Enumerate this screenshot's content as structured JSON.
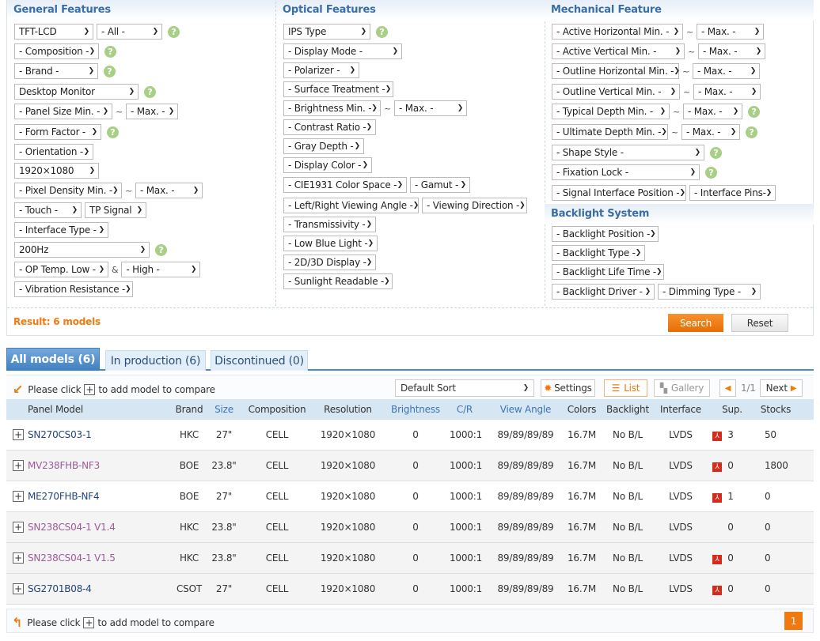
{
  "filters": {
    "general": {
      "title": "General Features",
      "rows": [
        [
          "TFT-LCD",
          "- All -",
          "?"
        ],
        [
          "- Composition -",
          "?"
        ],
        [
          "- Brand -",
          "?"
        ],
        [
          "Desktop Monitor",
          "?"
        ],
        [
          "- Panel Size Min. -",
          "~",
          "- Max. -"
        ],
        [
          "- Form Factor -",
          "?"
        ],
        [
          "- Orientation -"
        ],
        [
          "1920×1080"
        ],
        [
          "- Pixel Density Min. -",
          "~",
          "- Max. -"
        ],
        [
          "- Touch -",
          "TP Signal"
        ],
        [
          "- Interface Type -"
        ],
        [
          "200Hz",
          "?"
        ],
        [
          "- OP Temp. Low -",
          "&",
          "- High -"
        ],
        [
          "- Vibration Resistance -"
        ]
      ]
    },
    "optical": {
      "title": "Optical Features",
      "rows": [
        [
          "IPS Type",
          "?"
        ],
        [
          "- Display Mode -"
        ],
        [
          "- Polarizer -"
        ],
        [
          "- Surface Treatment -"
        ],
        [
          "- Brightness Min. -",
          "~",
          "- Max. -"
        ],
        [
          "- Contrast Ratio -"
        ],
        [
          "- Gray Depth -"
        ],
        [
          "- Display Color -"
        ],
        [
          "- CIE1931 Color Space -",
          "- Gamut -"
        ],
        [
          "- Left/Right Viewing Angle -",
          "- Viewing Direction -"
        ],
        [
          "- Transmissivity -"
        ],
        [
          "- Low Blue Light -"
        ],
        [
          "- 2D/3D Display -"
        ],
        [
          "- Sunlight Readable -"
        ]
      ]
    },
    "mechanical": {
      "title": "Mechanical Feature",
      "rows": [
        [
          "- Active Horizontal Min. -",
          "~",
          "- Max. -"
        ],
        [
          "- Active Vertical Min. -",
          "~",
          "- Max. -"
        ],
        [
          "- Outline Horizontal Min. -",
          "~",
          "- Max. -"
        ],
        [
          "- Outline Vertical Min. -",
          "~",
          "- Max. -"
        ],
        [
          "- Typical Depth Min. -",
          "~",
          "- Max. -",
          "?"
        ],
        [
          "- Ultimate Depth Min. -",
          "~",
          "- Max. -",
          "?"
        ],
        [
          "- Shape Style -",
          "?"
        ],
        [
          "- Fixation Lock -",
          "?"
        ],
        [
          "- Signal Interface Position -",
          "- Interface Pins-"
        ]
      ]
    },
    "backlight": {
      "title": "Backlight System",
      "rows": [
        [
          "- Backlight Position -"
        ],
        [
          "- Backlight Type -"
        ],
        [
          "- Backlight Life Time -"
        ],
        [
          "- Backlight Driver -",
          "- Dimming Type -"
        ]
      ]
    },
    "result": "Result: 6 models",
    "search_label": "Search",
    "reset_label": "Reset"
  },
  "tabs": [
    "All models (6)",
    "In production (6)",
    "Discontinued (0)"
  ],
  "toolbar": {
    "compare_pre": "Please click",
    "compare_post": "to add model to compare",
    "sort": "Default Sort",
    "settings": "Settings",
    "list": "List",
    "gallery": "Gallery",
    "page": "1/1",
    "next": "Next"
  },
  "table": {
    "headers": [
      "Panel Model",
      "Brand",
      "Size",
      "Composition",
      "Resolution",
      "Brightness",
      "C/R",
      "View Angle",
      "Colors",
      "Backlight",
      "Interface",
      "Sup.",
      "Stocks"
    ],
    "rows": [
      {
        "model": "SN270CS03-1",
        "brand": "HKC",
        "size": "27\"",
        "composition": "CELL",
        "resolution": "1920×1080",
        "brightness": "0",
        "cr": "1000:1",
        "view_angle": "89/89/89/89",
        "colors": "16.7M",
        "backlight": "No B/L",
        "interface": "LVDS",
        "pdf": true,
        "sup": "3",
        "stocks": "50",
        "visited": false
      },
      {
        "model": "MV238FHB-NF3",
        "brand": "BOE",
        "size": "23.8\"",
        "composition": "CELL",
        "resolution": "1920×1080",
        "brightness": "0",
        "cr": "1000:1",
        "view_angle": "89/89/89/89",
        "colors": "16.7M",
        "backlight": "No B/L",
        "interface": "LVDS",
        "pdf": true,
        "sup": "0",
        "stocks": "1800",
        "visited": true
      },
      {
        "model": "ME270FHB-NF4",
        "brand": "BOE",
        "size": "27\"",
        "composition": "CELL",
        "resolution": "1920×1080",
        "brightness": "0",
        "cr": "1000:1",
        "view_angle": "89/89/89/89",
        "colors": "16.7M",
        "backlight": "No B/L",
        "interface": "LVDS",
        "pdf": true,
        "sup": "1",
        "stocks": "0",
        "visited": false
      },
      {
        "model": "SN238CS04-1 V1.4",
        "brand": "HKC",
        "size": "23.8\"",
        "composition": "CELL",
        "resolution": "1920×1080",
        "brightness": "0",
        "cr": "1000:1",
        "view_angle": "89/89/89/89",
        "colors": "16.7M",
        "backlight": "No B/L",
        "interface": "LVDS",
        "pdf": false,
        "sup": "0",
        "stocks": "0",
        "visited": true
      },
      {
        "model": "SN238CS04-1 V1.5",
        "brand": "HKC",
        "size": "23.8\"",
        "composition": "CELL",
        "resolution": "1920×1080",
        "brightness": "0",
        "cr": "1000:1",
        "view_angle": "89/89/89/89",
        "colors": "16.7M",
        "backlight": "No B/L",
        "interface": "LVDS",
        "pdf": true,
        "sup": "0",
        "stocks": "0",
        "visited": true
      },
      {
        "model": "SG2701B08-4",
        "brand": "CSOT",
        "size": "27\"",
        "composition": "CELL",
        "resolution": "1920×1080",
        "brightness": "0",
        "cr": "1000:1",
        "view_angle": "89/89/89/89",
        "colors": "16.7M",
        "backlight": "No B/L",
        "interface": "LVDS",
        "pdf": true,
        "sup": "0",
        "stocks": "0",
        "visited": false
      }
    ]
  },
  "pagination": {
    "current": "1"
  },
  "colors": {
    "accent": "#f07a0f",
    "header_blue": "#3a6ea5",
    "help_green": "#a7cf86"
  }
}
